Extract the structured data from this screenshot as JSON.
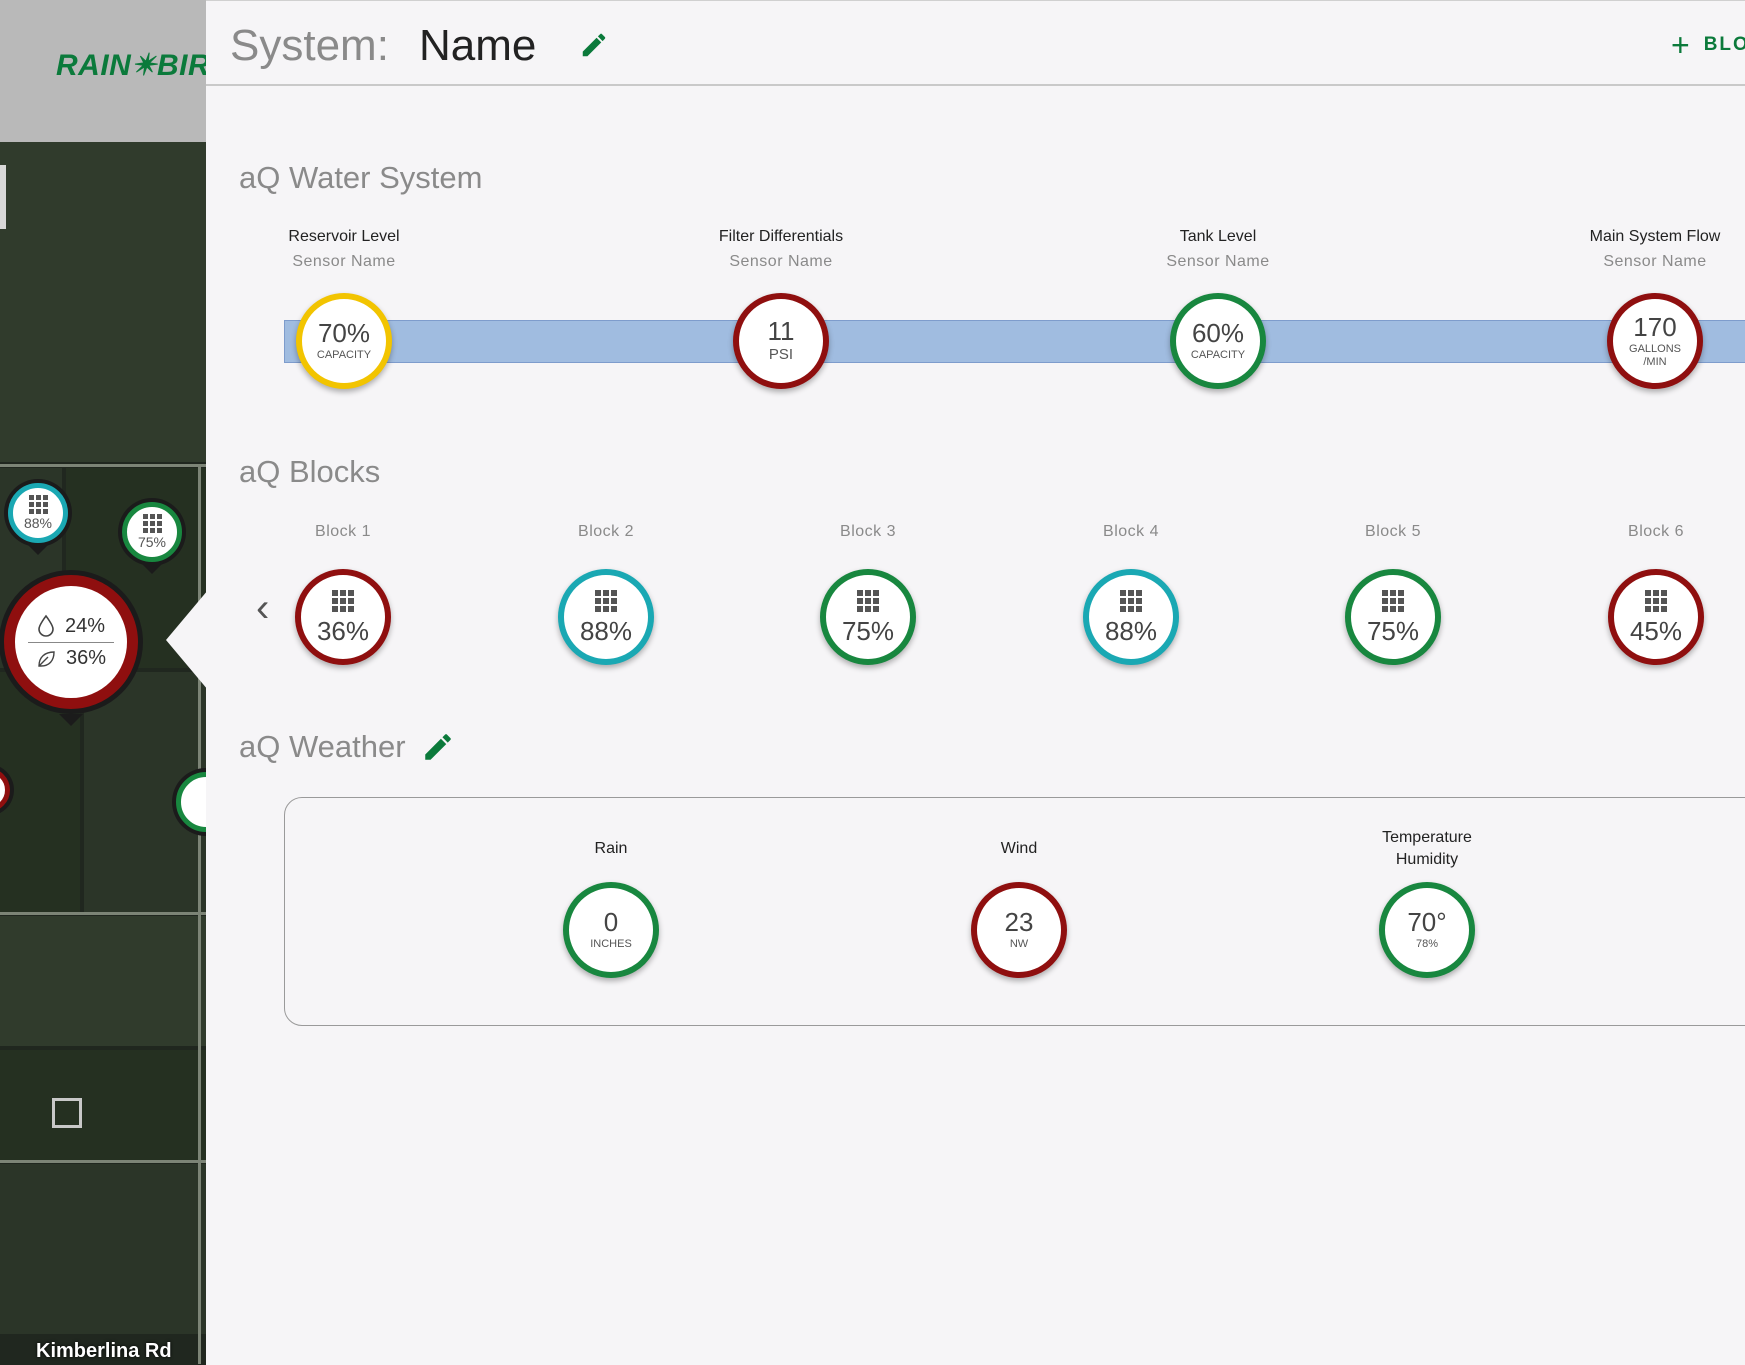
{
  "map": {
    "brand": "RAIN✴BIRD",
    "road_label": "Kimberlina Rd",
    "pins_small": [
      {
        "pct": "88%",
        "color": "#1aa8b3"
      },
      {
        "pct": "75%",
        "color": "#18873f"
      }
    ],
    "pin_big": {
      "water": "24%",
      "leaf": "36%",
      "color": "#8f0f0f"
    }
  },
  "header": {
    "label": "System:",
    "name": "Name",
    "add_button": "BLOCK"
  },
  "water_system": {
    "title": "aQ Water System",
    "sensors": [
      {
        "title": "Reservoir Level",
        "sensor": "Sensor Name",
        "value": "70%",
        "unit": "CAPACITY",
        "color": "yellow"
      },
      {
        "title": "Filter Differentials",
        "sensor": "Sensor Name",
        "value": "11",
        "unit": "PSI",
        "color": "red"
      },
      {
        "title": "Tank Level",
        "sensor": "Sensor Name",
        "value": "60%",
        "unit": "CAPACITY",
        "color": "green"
      },
      {
        "title": "Main System Flow",
        "sensor": "Sensor Name",
        "value": "170",
        "unit": "GALLONS /MIN",
        "color": "red"
      }
    ]
  },
  "blocks": {
    "title": "aQ Blocks",
    "items": [
      {
        "label": "Block 1",
        "value": "36%",
        "color": "red"
      },
      {
        "label": "Block 2",
        "value": "88%",
        "color": "teal"
      },
      {
        "label": "Block 3",
        "value": "75%",
        "color": "green"
      },
      {
        "label": "Block 4",
        "value": "88%",
        "color": "teal"
      },
      {
        "label": "Block 5",
        "value": "75%",
        "color": "green"
      },
      {
        "label": "Block 6",
        "value": "45%",
        "color": "red"
      }
    ]
  },
  "weather": {
    "title": "aQ Weather",
    "items": [
      {
        "label": "Rain",
        "value": "0",
        "unit": "INCHES",
        "color": "green"
      },
      {
        "label": "Wind",
        "value": "23",
        "unit": "NW",
        "color": "red"
      },
      {
        "label": "Temperature\nHumidity",
        "label_line1": "Temperature",
        "label_line2": "Humidity",
        "value": "70°",
        "unit": "78%",
        "color": "green"
      }
    ]
  },
  "colors": {
    "accent": "#0b7a3b",
    "red": "#8f0f0f",
    "green": "#18873f",
    "teal": "#1aa8b3",
    "yellow": "#f2c400",
    "pipe": "#a0bce0"
  },
  "icons": [
    "pencil-icon",
    "plus-icon",
    "grid-icon",
    "water-drop-icon",
    "leaf-icon",
    "chevron-left-icon"
  ]
}
